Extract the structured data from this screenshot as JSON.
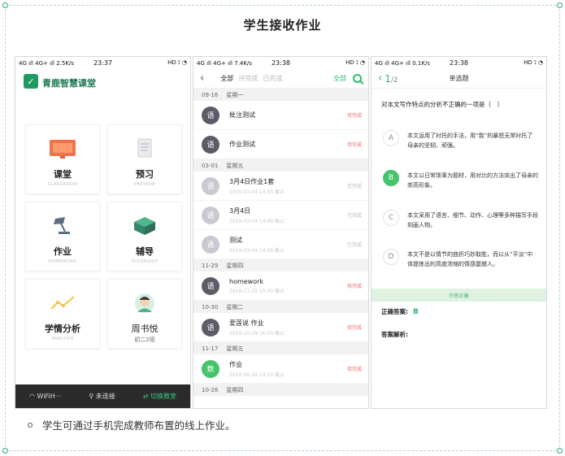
{
  "title": "学生接收作业",
  "caption": "学生可通过手机完成教师布置的线上作业。",
  "phone1": {
    "status": {
      "left": "4G ıll 4G+ ıll 2.5K/s",
      "time": "23:37",
      "right": "HD ⟟ ◔"
    },
    "app_name": "青鹿智慧课堂",
    "tiles": [
      {
        "label": "课堂",
        "en": "CLASSROOM"
      },
      {
        "label": "预习",
        "en": "PREVIEW"
      },
      {
        "label": "作业",
        "en": "HOMEWORK"
      },
      {
        "label": "辅导",
        "en": "TUTORSHIP"
      },
      {
        "label": "学情分析",
        "en": "ANALYSIS"
      },
      {
        "label": "周书悦",
        "sub": "初二2班"
      }
    ],
    "bottom": {
      "wifi": "WiFiH···",
      "connect": "未连接",
      "switch": "切换教室"
    }
  },
  "phone2": {
    "status": {
      "left": "4G ıll 4G+ ıll 7.4K/s",
      "time": "23:38",
      "right": "HD ⟟ ◔"
    },
    "tabs": [
      "全部",
      "待完成",
      "已完成"
    ],
    "filter": "全部",
    "sections": [
      {
        "date": "09-16",
        "weekday": "星期一",
        "items": [
          {
            "avatar": "语",
            "name": "批注测试",
            "date": "",
            "status": "待完成",
            "style": "dark"
          },
          {
            "avatar": "语",
            "name": "作业测试",
            "date": "",
            "status": "待完成",
            "style": "dark"
          }
        ]
      },
      {
        "date": "03-01",
        "weekday": "星期五",
        "items": [
          {
            "avatar": "语",
            "name": "3月4日作业1套",
            "date": "2019-03-04 14:53 截止",
            "status": "已完成",
            "style": "light"
          },
          {
            "avatar": "语",
            "name": "3月4日",
            "date": "2019-03-04 14:49 截止",
            "status": "已完成",
            "style": "light"
          },
          {
            "avatar": "语",
            "name": "测试",
            "date": "2019-03-04 14:06 截止",
            "status": "已完成",
            "style": "light"
          }
        ]
      },
      {
        "date": "11-29",
        "weekday": "星期四",
        "items": [
          {
            "avatar": "语",
            "name": "homework",
            "date": "2018-11-29 19:30 截止",
            "status": "待完成",
            "style": "dark"
          }
        ]
      },
      {
        "date": "10-30",
        "weekday": "星期二",
        "items": [
          {
            "avatar": "语",
            "name": "爱莲说 作业",
            "date": "2018-10-29 16:00 截止",
            "status": "待完成",
            "style": "dark"
          }
        ]
      },
      {
        "date": "11-17",
        "weekday": "星期五",
        "items": [
          {
            "avatar": "数",
            "name": "作业",
            "date": "2018-08-28 14:20 截止",
            "status": "待完成",
            "style": "green"
          }
        ]
      },
      {
        "date": "10-26",
        "weekday": "星期四",
        "items": []
      }
    ]
  },
  "phone3": {
    "status": {
      "left": "4G ıll 4G+ ıll 0.1K/s",
      "time": "23:38",
      "right": "HD ⟟ ◔"
    },
    "page_current": "1",
    "page_total": "/2",
    "qtype": "单选题",
    "stem": "对本文写作特点的分析不正确的一项是（　）",
    "options": [
      {
        "letter": "A",
        "text": "本文运用了衬托的手法，用“我”的暴怒无常衬托了母亲的坚韧、顽强。"
      },
      {
        "letter": "B",
        "text": "本文以日常琐事为题材，用对比的方法突出了母亲的崇高形象。"
      },
      {
        "letter": "C",
        "text": "本文采用了语言、细节、动作、心理等多种描写手段刻画人物。"
      },
      {
        "letter": "D",
        "text": "本文不是以情节的曲折巧妙取胜，而以从“平淡”中体提炼出的高度浓缩的情感震撼人。"
      }
    ],
    "banner": "作答正确",
    "answer_label": "正确答案:",
    "answer_value": "B",
    "explain_label": "答案解析:"
  }
}
